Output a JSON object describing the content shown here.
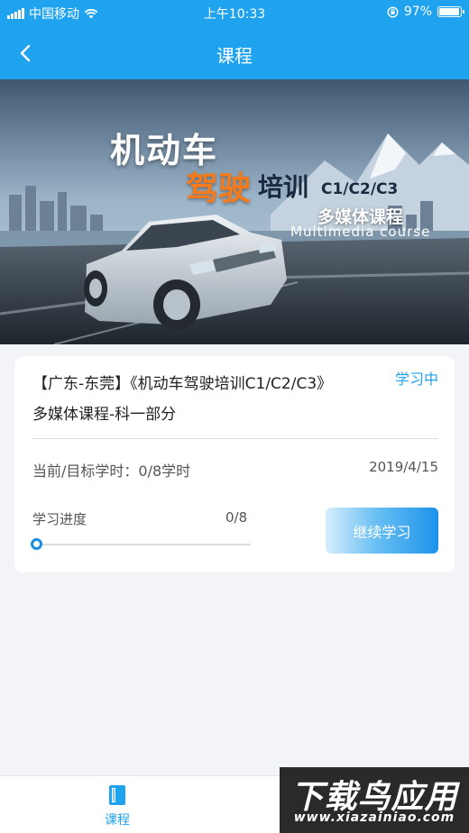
{
  "status_bar": {
    "carrier": "中国移动",
    "time": "上午10:33",
    "battery": "97%",
    "battery_level": 0.97
  },
  "navbar": {
    "title": "课程",
    "back_icon": "chevron-left-icon"
  },
  "banner": {
    "line1": "机动车",
    "line2a": "驾驶",
    "line2b": "培训",
    "line2c": "C1/C2/C3",
    "line3": "多媒体课程",
    "line4": "Multimedia course"
  },
  "course": {
    "title": "【广东-东莞】《机动车驾驶培训C1/C2/C3》多媒体课程-科一部分",
    "status": "学习中",
    "hours": "当前/目标学时：0/8学时",
    "date": "2019/4/15",
    "progress_label": "学习进度",
    "progress_value": "0/8",
    "progress_fraction": 0,
    "continue_label": "继续学习"
  },
  "tabbar": {
    "items": [
      {
        "label": "课程",
        "icon": "book-icon",
        "active": true
      }
    ]
  },
  "watermark": {
    "big": "下载鸟应用",
    "small": "www.xiazainiao.com"
  },
  "colors": {
    "primary": "#1fa3ee",
    "accent_orange": "#f47a1c",
    "background": "#f3f4f8"
  }
}
